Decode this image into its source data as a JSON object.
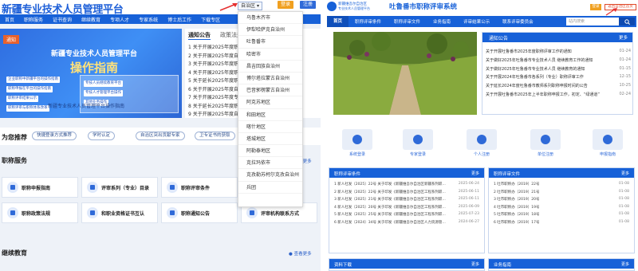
{
  "left": {
    "logo": "新疆专业技术人员管理平台",
    "nav": [
      "首页",
      "职称服务",
      "证书查询",
      "继续教育",
      "专项人才",
      "专家系统",
      "博士后工作",
      "下载专区"
    ],
    "region_select": "自治区",
    "login_label": "登录",
    "register_label": "注册",
    "banner": {
      "tag": "通知",
      "title1": "新疆专业技术人员管理平台",
      "title2": "操作指南",
      "pills": [
        "企业职称中新疆平台的操作指南",
        "职称申报在平台的操作指南",
        "职称评审结果公示",
        "职称评审与职称体系改革",
        "专技人员继续教育平台",
        "专技人才管理平台操作",
        "其他业务操作"
      ],
      "caption": "新疆专业技术人员管理平台操作指南"
    },
    "notice": {
      "tab_active": "通知公告",
      "tab_other": "政策法规",
      "items": [
        "1 关于开展2025年度职称评审工作的通知",
        "2 关于开展2025年度自治区职称评审工作",
        "3 关于开展2025年度职称申报工作的通知",
        "4 关于开展2025年度职称评审结果公示",
        "5 关于延长2025年度职称评审申报时间",
        "6 关于开展2025年度自治区继续教育工作",
        "7 关于开展2025年度专业技术人员职称",
        "8 关于延长2025年度职称申报截止时间",
        "9 关于开展2025年度自治区职称评审工作"
      ]
    },
    "recommend": {
      "title": "为您推荐",
      "buttons": [
        "快捷登录方式推荐",
        "学时认定",
        "自治区突出贡献专家",
        "卫专证书的获取"
      ]
    },
    "service": {
      "title": "职称服务",
      "more": "查看更多",
      "items": [
        "职称申报指南",
        "评审系列（专业）目录",
        "职称评审条件",
        "职称政策法规",
        "和职业资格证书互认",
        "职称通知公告",
        "评审机构联系方式"
      ]
    },
    "education": {
      "title": "继续教育",
      "more": "查看更多"
    },
    "dropdown": [
      "乌鲁木齐市",
      "伊犁哈萨克自治州",
      "吐鲁番市",
      "哈密市",
      "昌吉回族自治州",
      "博尔塔拉蒙古自治州",
      "巴音郭楞蒙古自治州",
      "阿克苏地区",
      "和田地区",
      "喀什地区",
      "塔城地区",
      "阿勒泰地区",
      "克拉玛依市",
      "克孜勒苏柯尔克孜自治州",
      "兵团"
    ]
  },
  "right": {
    "logo_small1": "新疆维吾尔自治区",
    "logo_small2": "专业技术人员管理平台",
    "logo_main": "吐鲁番市职称评审系统",
    "login_label": "登录",
    "back_label": "返回自治区首页",
    "nav": [
      "首页",
      "职称评审条件",
      "职称评审文件",
      "业务指南",
      "评审结果公示",
      "联系评审委员会"
    ],
    "search_placeholder": "站内搜索",
    "notice": {
      "title": "通知公告",
      "more": "更多",
      "items": [
        {
          "t": "关于开展吐鲁番市2025年度职称评审工作的通知",
          "d": "01-24"
        },
        {
          "t": "关于做好2025年吐鲁番市专业技术人员 继续教育工作的通知",
          "d": "01-24"
        },
        {
          "t": "关于做好2025年吐鲁番市专业技术人员 继续教育的通知",
          "d": "01-15"
        },
        {
          "t": "关于开展2024年吐鲁番市各系列（专业）职称评审工作",
          "d": "12-15"
        },
        {
          "t": "关于延长2024年度吐鲁番市教师系列职称申报时间的公告",
          "d": "10-25"
        },
        {
          "t": "关于开展吐鲁番市2025年上半年职称申报工作，初定、“绿通道”",
          "d": "02-24"
        }
      ]
    },
    "quick": [
      "系统登录",
      "专家登录",
      "个人注册",
      "单位注册",
      "申报指南"
    ],
    "panels": [
      {
        "title": "职称评审条件",
        "more": "更多",
        "items": [
          {
            "t": "1 新人社发〔2025〕22号 关于印发《新疆维吾尔自治区新疆系列职…",
            "d": "2025-06-24"
          },
          {
            "t": "2 新人社发〔2025〕22号 关于印发《新疆维吾尔自治区工程系列职…",
            "d": "2025-06-11"
          },
          {
            "t": "3 新人社发〔2025〕21号 关于印发《新疆维吾尔自治区工程系列职…",
            "d": "2025-06-11"
          },
          {
            "t": "4 新人社发〔2025〕20号 关于印发《新疆维吾尔自治区工程系列职…",
            "d": "2025-06-09"
          },
          {
            "t": "5 新人社发〔2025〕25号 关于印发《新疆维吾尔自治区工程系列职…",
            "d": "2025-07-23"
          },
          {
            "t": "6 新人社发〔2024〕34号 关于印发《新疆维吾尔自治区人力资源管…",
            "d": "2024-06-27"
          }
        ]
      },
      {
        "title": "职称评审文件",
        "more": "更多",
        "items": [
          {
            "t": "1 吐市职称办〔2019〕22号",
            "d": "01-08"
          },
          {
            "t": "2 吐市职称办〔2019〕21号",
            "d": "01-08"
          },
          {
            "t": "3 吐市职称办〔2019〕20号",
            "d": "01-08"
          },
          {
            "t": "4 吐市职称办〔2019〕19号",
            "d": "01-08"
          },
          {
            "t": "5 吐市职称办〔2019〕18号",
            "d": "01-08"
          },
          {
            "t": "6 吐市职称办〔2019〕17号",
            "d": "01-08"
          }
        ]
      },
      {
        "title": "资料下载",
        "more": "更多",
        "items": []
      },
      {
        "title": "业务指南",
        "more": "更多",
        "items": []
      }
    ]
  },
  "colors": {
    "primary": "#1761d8",
    "accent_orange": "#f0a020",
    "annotation_red": "#e53030"
  }
}
